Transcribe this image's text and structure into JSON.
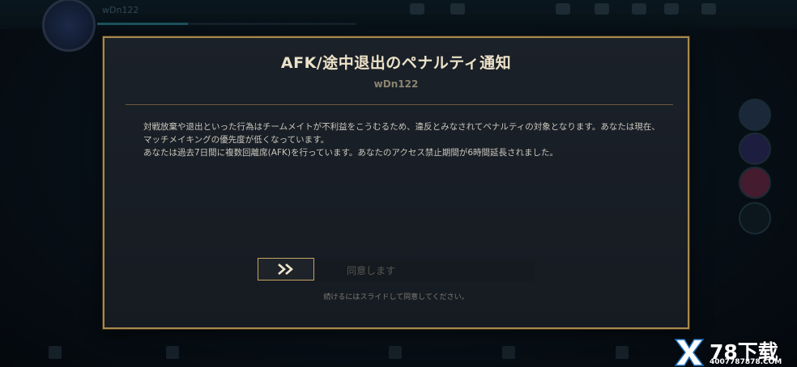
{
  "background": {
    "player_name": "wDn122"
  },
  "dialog": {
    "title": "AFK/途中退出のペナルティ通知",
    "subtitle": "wDn122",
    "paragraphs": [
      "対戦放棄や退出といった行為はチームメイトが不利益をこうむるため、違反とみなされてペナルティの対象となります。あなたは現在、マッチメイキングの優先度が低くなっています。",
      "あなたは過去7日間に複数回離席(AFK)を行っています。あなたのアクセス禁止期間が6時間延長されました。"
    ],
    "slider": {
      "label": "同意します",
      "handle_icon": "double-chevron-right-icon"
    },
    "hint": "続けるにはスライドして同意してください。"
  },
  "watermark": {
    "brand": "78下载",
    "url": "4007787878.COM"
  },
  "colors": {
    "border_gold": "#a88a4e",
    "title": "#ece2c8",
    "handle_gold": "#c6a460"
  }
}
